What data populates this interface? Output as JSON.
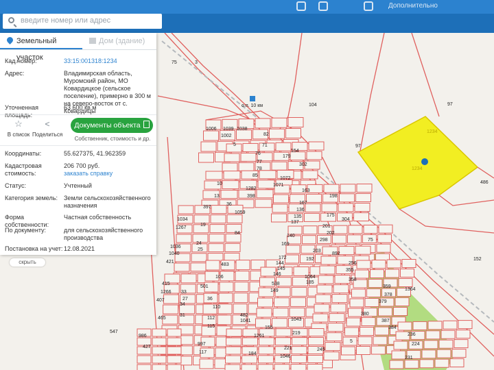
{
  "search": {
    "placeholder": "введите номер или адрес"
  },
  "tabs": {
    "land": "Земельный участок",
    "building": "Дом (здание)"
  },
  "info": {
    "cadastral_label": "Кад.номер:",
    "cadastral_value": "33:15:001318:1234",
    "address_label": "Адрес:",
    "address_value": "Владимирская область, Муромский район, МО Ковардицкое (сельское поселение), примерно в 300 м на северо-восток от с. Ковардицы",
    "area_label": "Уточненная площадь:",
    "area_value": "63 600 кв.м",
    "coords_label": "Координаты:",
    "coords_value": "55.627375, 41.962359",
    "cost_label": "Кадастровая стоимость:",
    "cost_value": "206 700 руб.",
    "cost_link": "заказать справку",
    "status_label": "Статус:",
    "status_value": "Учтенный",
    "category_label": "Категория земель:",
    "category_value": "Земли сельскохозяйственного назначения",
    "ownership_label": "Форма собственности:",
    "ownership_value": "Частная собственность",
    "doc_label": "По документу:",
    "doc_value": "для сельскохозяйственного производства",
    "reg_label": "Постановка на учет:",
    "reg_value": "12.08.2021"
  },
  "actions": {
    "save": "В список",
    "share": "Поделиться",
    "docs_button": "Документы объекта",
    "docs_sub": "Собственник, стоимость и др."
  },
  "collapse": "скрыть",
  "topbar_right": "Дополнительно",
  "map": {
    "station": "о.п. 10 км",
    "parcel_labels": [
      "1234",
      "1234"
    ],
    "labels": [
      {
        "t": "75"
      },
      {
        "t": "3"
      },
      {
        "t": "104"
      },
      {
        "t": "97"
      },
      {
        "t": "97"
      },
      {
        "t": "486"
      },
      {
        "t": "152"
      },
      {
        "t": "1006"
      },
      {
        "t": "1039"
      },
      {
        "t": "1038"
      },
      {
        "t": "1002"
      },
      {
        "t": "82"
      },
      {
        "t": "5"
      },
      {
        "t": "71"
      },
      {
        "t": "76"
      },
      {
        "t": "77"
      },
      {
        "t": "78"
      },
      {
        "t": "85"
      },
      {
        "t": "154"
      },
      {
        "t": "179"
      },
      {
        "t": "302"
      },
      {
        "t": "1072"
      },
      {
        "t": "1071"
      },
      {
        "t": "163"
      },
      {
        "t": "198"
      },
      {
        "t": "10"
      },
      {
        "t": "1282"
      },
      {
        "t": "398"
      },
      {
        "t": "13"
      },
      {
        "t": "36"
      },
      {
        "t": "167"
      },
      {
        "t": "136"
      },
      {
        "t": "135"
      },
      {
        "t": "137"
      },
      {
        "t": "175"
      },
      {
        "t": "304"
      },
      {
        "t": "201"
      },
      {
        "t": "202"
      },
      {
        "t": "298"
      },
      {
        "t": "397"
      },
      {
        "t": "1059"
      },
      {
        "t": "1034"
      },
      {
        "t": "1267"
      },
      {
        "t": "19"
      },
      {
        "t": "84"
      },
      {
        "t": "140"
      },
      {
        "t": "169"
      },
      {
        "t": "203"
      },
      {
        "t": "892"
      },
      {
        "t": "172"
      },
      {
        "t": "144"
      },
      {
        "t": "145"
      },
      {
        "t": "146"
      },
      {
        "t": "192"
      },
      {
        "t": "1036"
      },
      {
        "t": "24"
      },
      {
        "t": "25"
      },
      {
        "t": "1040"
      },
      {
        "t": "421"
      },
      {
        "t": "483"
      },
      {
        "t": "106"
      },
      {
        "t": "501"
      },
      {
        "t": "1064"
      },
      {
        "t": "538"
      },
      {
        "t": "149"
      },
      {
        "t": "185"
      },
      {
        "t": "415"
      },
      {
        "t": "1266"
      },
      {
        "t": "407"
      },
      {
        "t": "33"
      },
      {
        "t": "27"
      },
      {
        "t": "36"
      },
      {
        "t": "110"
      },
      {
        "t": "34"
      },
      {
        "t": "31"
      },
      {
        "t": "465"
      },
      {
        "t": "112"
      },
      {
        "t": "115"
      },
      {
        "t": "482"
      },
      {
        "t": "1041"
      },
      {
        "t": "1043"
      },
      {
        "t": "155"
      },
      {
        "t": "219"
      },
      {
        "t": "1261"
      },
      {
        "t": "986"
      },
      {
        "t": "427"
      },
      {
        "t": "997"
      },
      {
        "t": "117"
      },
      {
        "t": "184"
      },
      {
        "t": "221"
      },
      {
        "t": "1046"
      },
      {
        "t": "245"
      },
      {
        "t": "547"
      },
      {
        "t": "256"
      },
      {
        "t": "355"
      },
      {
        "t": "358"
      },
      {
        "t": "359"
      },
      {
        "t": "378"
      },
      {
        "t": "379"
      },
      {
        "t": "380"
      },
      {
        "t": "387"
      },
      {
        "t": "384"
      },
      {
        "t": "236"
      },
      {
        "t": "224"
      },
      {
        "t": "231"
      },
      {
        "t": "1364"
      },
      {
        "t": "75"
      },
      {
        "t": "5"
      }
    ]
  },
  "colors": {
    "brand": "#1d6fb8",
    "parcel_line": "#e0605e",
    "highlight": "#f2ee22",
    "green": "#a6d86e",
    "button": "#29a33f"
  }
}
